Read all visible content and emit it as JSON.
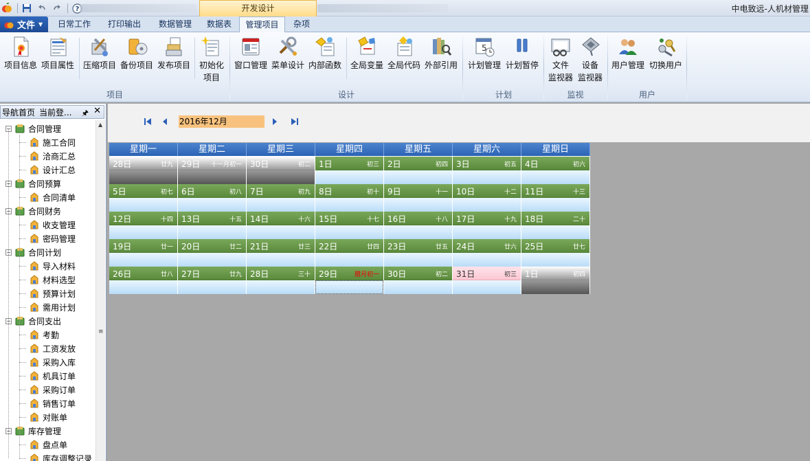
{
  "titlebar": {
    "context_tab": "开发设计",
    "window_title": "中电致远-人机材管理"
  },
  "tabs": {
    "file_label": "文件",
    "items": [
      "日常工作",
      "打印输出",
      "数据管理",
      "数据表",
      "管理项目",
      "杂项"
    ],
    "active": "管理项目"
  },
  "ribbon": {
    "groups": [
      {
        "label": "项目",
        "buttons": [
          "项目信息",
          "项目属性",
          "压缩项目",
          "备份项目",
          "发布项目",
          "初始化项目"
        ]
      },
      {
        "label": "设计",
        "buttons": [
          "窗口管理",
          "菜单设计",
          "内部函数",
          "全局变量",
          "全局代码",
          "外部引用"
        ]
      },
      {
        "label": "计划",
        "buttons": [
          "计划管理",
          "计划暂停"
        ]
      },
      {
        "label": "监视",
        "buttons": [
          "文件监视器",
          "设备监视器"
        ]
      },
      {
        "label": "用户",
        "buttons": [
          "用户管理",
          "切换用户"
        ]
      }
    ],
    "b_xmxx": "项目信息",
    "b_xmsx": "项目属性",
    "b_ysxm": "压缩项目",
    "b_bfxm": "备份项目",
    "b_fbxm": "发布项目",
    "b_csh_1": "初始化",
    "b_csh_2": "项目",
    "b_ckgl": "窗口管理",
    "b_cdsj": "菜单设计",
    "b_nbhs": "内部函数",
    "b_qjbl": "全局变量",
    "b_qjdm": "全局代码",
    "b_wbyy": "外部引用",
    "b_jhgl": "计划管理",
    "b_jhzt": "计划暂停",
    "b_wj_1": "文件",
    "b_wj_2": "监视器",
    "b_sb_1": "设备",
    "b_sb_2": "监视器",
    "b_yhgl": "用户管理",
    "b_qhyh": "切换用户",
    "g_xm": "项目",
    "g_sj": "设计",
    "g_jh": "计划",
    "g_js": "监视",
    "g_yh": "用户"
  },
  "panel": {
    "tab1": "导航首页",
    "tab2": "当前登...",
    "tree": [
      {
        "label": "合同管理",
        "level": 0
      },
      {
        "label": "施工合同",
        "level": 1
      },
      {
        "label": "洽商汇总",
        "level": 1
      },
      {
        "label": "设计汇总",
        "level": 1
      },
      {
        "label": "合同预算",
        "level": 0
      },
      {
        "label": "合同清单",
        "level": 1
      },
      {
        "label": "合同财务",
        "level": 0
      },
      {
        "label": "收支管理",
        "level": 1
      },
      {
        "label": "密码管理",
        "level": 1
      },
      {
        "label": "合同计划",
        "level": 0
      },
      {
        "label": "导入材料",
        "level": 1
      },
      {
        "label": "材料选型",
        "level": 1
      },
      {
        "label": "预算计划",
        "level": 1
      },
      {
        "label": "需用计划",
        "level": 1
      },
      {
        "label": "合同支出",
        "level": 0
      },
      {
        "label": "考勤",
        "level": 1
      },
      {
        "label": "工资发放",
        "level": 1
      },
      {
        "label": "采购入库",
        "level": 1
      },
      {
        "label": "机具订单",
        "level": 1
      },
      {
        "label": "采购订单",
        "level": 1
      },
      {
        "label": "销售订单",
        "level": 1
      },
      {
        "label": "对账单",
        "level": 1
      },
      {
        "label": "库存管理",
        "level": 0
      },
      {
        "label": "盘点单",
        "level": 1
      },
      {
        "label": "库存调整记录",
        "level": 1
      }
    ]
  },
  "calendar": {
    "month": "2016年12月",
    "weekdays": [
      "星期一",
      "星期二",
      "星期三",
      "星期四",
      "星期五",
      "星期六",
      "星期日"
    ],
    "weeks": [
      [
        {
          "d": "28日",
          "l": "廿九",
          "s": "gray"
        },
        {
          "d": "29日",
          "l": "十一月初一",
          "s": "gray",
          "red": true
        },
        {
          "d": "30日",
          "l": "初二",
          "s": "gray"
        },
        {
          "d": "1日",
          "l": "初三"
        },
        {
          "d": "2日",
          "l": "初四"
        },
        {
          "d": "3日",
          "l": "初五"
        },
        {
          "d": "4日",
          "l": "初六"
        }
      ],
      [
        {
          "d": "5日",
          "l": "初七"
        },
        {
          "d": "6日",
          "l": "初八"
        },
        {
          "d": "7日",
          "l": "初九"
        },
        {
          "d": "8日",
          "l": "初十"
        },
        {
          "d": "9日",
          "l": "十一"
        },
        {
          "d": "10日",
          "l": "十二"
        },
        {
          "d": "11日",
          "l": "十三"
        }
      ],
      [
        {
          "d": "12日",
          "l": "十四"
        },
        {
          "d": "13日",
          "l": "十五"
        },
        {
          "d": "14日",
          "l": "十六"
        },
        {
          "d": "15日",
          "l": "十七"
        },
        {
          "d": "16日",
          "l": "十八"
        },
        {
          "d": "17日",
          "l": "十九"
        },
        {
          "d": "18日",
          "l": "二十"
        }
      ],
      [
        {
          "d": "19日",
          "l": "廿一"
        },
        {
          "d": "20日",
          "l": "廿二"
        },
        {
          "d": "21日",
          "l": "廿三"
        },
        {
          "d": "22日",
          "l": "廿四"
        },
        {
          "d": "23日",
          "l": "廿五"
        },
        {
          "d": "24日",
          "l": "廿六"
        },
        {
          "d": "25日",
          "l": "廿七"
        }
      ],
      [
        {
          "d": "26日",
          "l": "廿八"
        },
        {
          "d": "27日",
          "l": "廿九"
        },
        {
          "d": "28日",
          "l": "三十"
        },
        {
          "d": "29日",
          "l": "腊月初一",
          "red": true,
          "sel": true
        },
        {
          "d": "30日",
          "l": "初二"
        },
        {
          "d": "31日",
          "l": "初三",
          "s": "today"
        },
        {
          "d": "1日",
          "l": "初四",
          "s": "gray"
        }
      ]
    ]
  }
}
